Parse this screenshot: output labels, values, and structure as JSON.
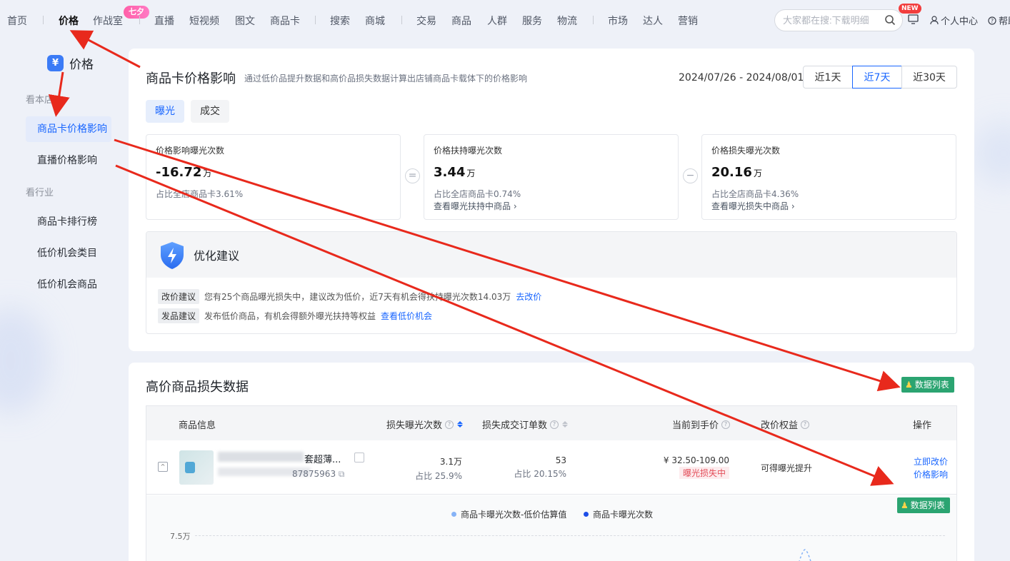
{
  "nav": {
    "items": [
      "首页",
      "价格",
      "作战室",
      "直播",
      "短视频",
      "图文",
      "商品卡",
      "搜索",
      "商城",
      "交易",
      "商品",
      "人群",
      "服务",
      "物流",
      "市场",
      "达人",
      "营销"
    ],
    "badge_7": "七夕",
    "search_placeholder": "大家都在搜:下载明细",
    "new_badge": "NEW",
    "personal": "个人中心",
    "help": "帮助"
  },
  "sidebar": {
    "brand": "价格",
    "brand_logo": "¥",
    "group1": "看本店",
    "group2": "看行业",
    "items": [
      "商品卡价格影响",
      "直播价格影响",
      "商品卡排行榜",
      "低价机会类目",
      "低价机会商品"
    ]
  },
  "card1": {
    "title": "商品卡价格影响",
    "desc": "通过低价品提升数据和高价品损失数据计算出店铺商品卡载体下的价格影响",
    "date_range": "2024/07/26 - 2024/08/01",
    "range_buttons": [
      "近1天",
      "近7天",
      "近30天"
    ],
    "tabs": [
      "曝光",
      "成交"
    ],
    "metrics": [
      {
        "label": "价格影响曝光次数",
        "value": "-16.72",
        "unit": "万",
        "sub": "占比全店商品卡3.61%",
        "link": ""
      },
      {
        "label": "价格扶持曝光次数",
        "value": "3.44",
        "unit": "万",
        "sub": "占比全店商品卡0.74%",
        "link": "查看曝光扶持中商品 ›"
      },
      {
        "label": "价格损失曝光次数",
        "value": "20.16",
        "unit": "万",
        "sub": "占比全店商品卡4.36%",
        "link": "查看曝光损失中商品 ›"
      }
    ],
    "ops": [
      "=",
      "−"
    ],
    "advice_title": "优化建议",
    "advice": [
      {
        "tag": "改价建议",
        "text": "您有25个商品曝光损失中，建议改为低价，近7天有机会得扶持曝光次数14.03万",
        "link": "去改价"
      },
      {
        "tag": "发品建议",
        "text": "发布低价商品，有机会得额外曝光扶持等权益",
        "link": "查看低价机会"
      }
    ]
  },
  "card2": {
    "title": "高价商品损失数据",
    "data_list_btn": "数据列表",
    "columns": [
      "商品信息",
      "损失曝光次数",
      "损失成交订单数",
      "当前到手价",
      "改价权益",
      "操作"
    ],
    "row": {
      "name": "套超薄...",
      "id": "87875963",
      "lost_exposure": "3.1万",
      "lost_exposure_share": "占比 25.9%",
      "lost_orders": "53",
      "lost_orders_share": "占比 20.15%",
      "price": "¥ 32.50-109.00",
      "status": "曝光损失中",
      "benefit": "可得曝光提升",
      "actions": [
        "立即改价",
        "价格影响"
      ]
    },
    "chart_legend": [
      "商品卡曝光次数-低价估算值",
      "商品卡曝光次数"
    ],
    "chart_ytick": "7.5万",
    "legend_colors": [
      "#86b3f7",
      "#1e4ee8"
    ]
  }
}
